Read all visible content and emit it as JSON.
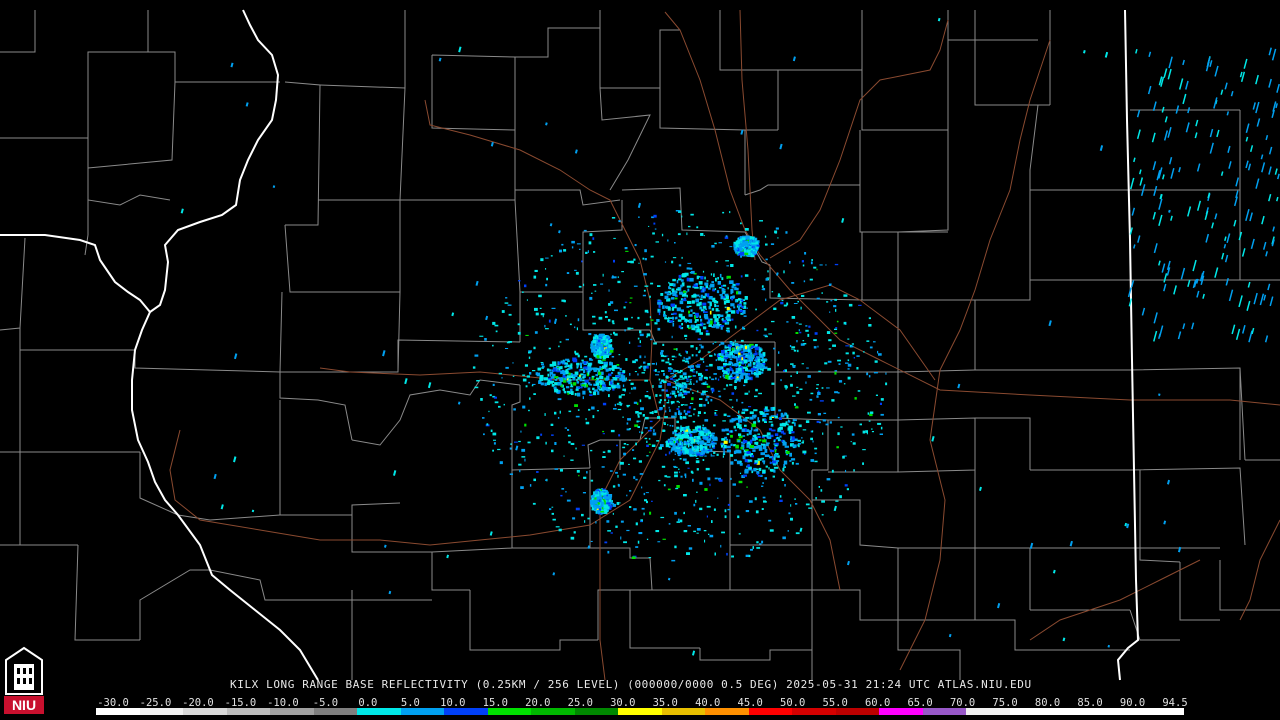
{
  "product": {
    "station": "KILX",
    "caption": "KILX LONG RANGE BASE REFLECTIVITY (0.25KM / 256 LEVEL) (000000/0000 0.5 DEG) 2025-05-31 21:24 UTC  ATLAS.NIU.EDU"
  },
  "logo": {
    "text": "NIU",
    "colors": {
      "red": "#c8102e",
      "white": "#ffffff",
      "black": "#000000"
    }
  },
  "legend": {
    "labels": [
      "-30.0",
      "-25.0",
      "-20.0",
      "-15.0",
      "-10.0",
      "-5.0",
      "0.0",
      "5.0",
      "10.0",
      "15.0",
      "20.0",
      "25.0",
      "30.0",
      "35.0",
      "40.0",
      "45.0",
      "50.0",
      "55.0",
      "60.0",
      "65.0",
      "70.0",
      "75.0",
      "80.0",
      "85.0",
      "90.0",
      "94.5"
    ],
    "colors": [
      "#ffffff",
      "#f0f0f0",
      "#d8d8d8",
      "#bcbcbc",
      "#a0a0a0",
      "#7f7f7f",
      "#00e8e8",
      "#00a0f0",
      "#0040f8",
      "#00e000",
      "#00b800",
      "#008800",
      "#ffff00",
      "#e8c000",
      "#ff9000",
      "#ff0000",
      "#d40000",
      "#bc0000",
      "#ff00ff",
      "#9858c8",
      "#f0f0f0",
      "#ffffff",
      "#ffffff",
      "#ffffff",
      "#ffffff"
    ]
  },
  "map_style": {
    "background": "#000000",
    "county_lines": "#8c8c8c",
    "state_lines": "#ffffff",
    "highways": "#8a4a30",
    "echo_colors": [
      "#00e8e8",
      "#00a0f0",
      "#0040f8",
      "#00e000",
      "#ffff00"
    ]
  }
}
